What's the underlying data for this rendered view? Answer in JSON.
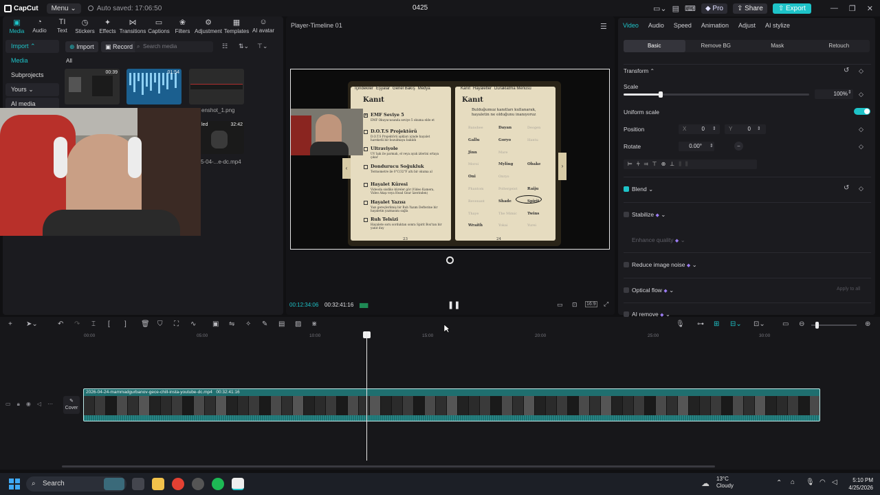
{
  "app": {
    "logo": "CapCut",
    "menu": "Menu",
    "autosave": "Auto saved: 17:06:50",
    "title": "0425",
    "pro": "Pro",
    "share": "Share",
    "export": "Export"
  },
  "media_tabs": [
    "Media",
    "Audio",
    "Text",
    "Stickers",
    "Effects",
    "Transitions",
    "Captions",
    "Filters",
    "Adjustment",
    "Templates",
    "AI avatar"
  ],
  "side": {
    "import": "Import",
    "media": "Media",
    "subprojects": "Subprojects",
    "yours": "Yours",
    "ai_media": "AI media"
  },
  "media_toolbar": {
    "import": "Import",
    "record": "Record",
    "search_placeholder": "Search media",
    "all": "All"
  },
  "media_items": [
    {
      "duration": "00:39",
      "name": ""
    },
    {
      "duration": "01:54",
      "name": ""
    },
    {
      "duration": "",
      "name": "enshot_1.png"
    },
    {
      "duration": "32:42",
      "name": "5-04-...e-dc.mp4",
      "status": "led"
    }
  ],
  "preview": {
    "header": "Player-Timeline 01",
    "current_time": "00:12:34:06",
    "total_time": "00:32:41:16",
    "ratio": "16:9",
    "book": {
      "tabs_left": [
        "İçindekiler",
        "Eşyalar",
        "Genel Bakış",
        "Medya"
      ],
      "tabs_right": [
        "Kanıt",
        "Hayaletler",
        "Duraklatma Menüsü"
      ],
      "left_title": "Kanıt",
      "right_title": "Kanıt",
      "right_desc": "Bulduğumuz kanıtları kullanarak, hayaletin ne olduğunu inanıyoruz",
      "left_items": [
        {
          "name": "EMF Seviye 5",
          "desc": "EMF Okuyucusunda seviye 5 okuma elde et",
          "checked": true
        },
        {
          "name": "D.O.T.S Projektörü",
          "desc": "D.O.T.S Projektörü ışıkları içinde hayalet hareketli bir bozulmaya bakıldı",
          "checked": false
        },
        {
          "name": "Ultraviyole",
          "desc": "UV Işık ile parmak, el veya ayak izlerini ortaya çıkar",
          "checked": false
        },
        {
          "name": "Dondurucu Soğukluk",
          "desc": "Termometre ile 0°C/32°F altı bir okuma al",
          "checked": false
        },
        {
          "name": "Hayalet Küresi",
          "desc": "Videoda sisdiko küreler gör (Video Kamera, Video Akışı veya Head Gear üzerinden)",
          "checked": false
        },
        {
          "name": "Hayalet Yazısı",
          "desc": "Yazı gereçlerlimiş bir Ruh Yazım Defterine bir hayaletin yazmasını sağla",
          "checked": false
        },
        {
          "name": "Ruh Telsizi",
          "desc": "Hayalete soru sorduktan sonra Spirit Box'tan bir yanıt duy",
          "checked": false
        }
      ],
      "ghosts": [
        [
          "Banshee",
          "Dayan",
          "Deogen"
        ],
        [
          "Gallu",
          "Goryo",
          "Hantu"
        ],
        [
          "Jinn",
          "Mare"
        ],
        [
          "Moroi",
          "Myling",
          "Obake"
        ],
        [
          "Oni",
          "Onryo"
        ],
        [
          "Phantom",
          "Poltergeist",
          "Raiju"
        ],
        [
          "Revenant",
          "Shade",
          "Spirit"
        ],
        [
          "Thaye",
          "The Mimic",
          "Twins"
        ],
        [
          "Wraith",
          "Yokai",
          "Yurei"
        ]
      ],
      "page_left": "23",
      "page_right": "24"
    }
  },
  "props": {
    "tabs": [
      "Video",
      "Audio",
      "Speed",
      "Animation",
      "Adjust",
      "AI stylize"
    ],
    "sub_tabs": [
      "Basic",
      "Remove BG",
      "Mask",
      "Retouch"
    ],
    "transform": "Transform",
    "scale": "Scale",
    "scale_value": "100%",
    "scale_level": 0.2,
    "uniform": "Uniform scale",
    "position": "Position",
    "pos_x_label": "X",
    "pos_x": "0",
    "pos_y_label": "Y",
    "pos_y": "0",
    "rotate": "Rotate",
    "rotate_value": "0.00°",
    "blend": "Blend",
    "stabilize": "Stabilize",
    "enhance": "Enhance quality",
    "reduce_noise": "Reduce image noise",
    "optical": "Optical flow",
    "apply_all": "Apply to all",
    "ai_remove": "AI remove"
  },
  "timeline": {
    "ticks": [
      "00:00",
      "05:00",
      "10:00",
      "15:00",
      "20:00",
      "25:00",
      "30:00"
    ],
    "clip_name": "2026-04-24-mammadgurbanov-gece-chill-insta-youtube-dc.mp4",
    "clip_duration": "00:32:41:16",
    "cover": "Cover"
  },
  "taskbar": {
    "search": "Search",
    "temp": "13°C",
    "weather": "Cloudy",
    "time": "5:10 PM",
    "date": "4/25/2026"
  }
}
